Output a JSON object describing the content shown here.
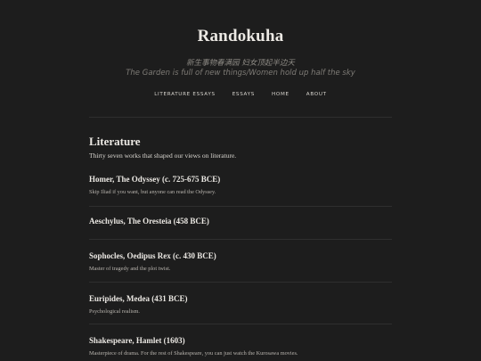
{
  "header": {
    "title": "Randokuha",
    "tagline_cn": "新生事物春满园 妇女顶起半边天",
    "tagline_en": "The Garden is full of new things/Women hold up half the sky"
  },
  "nav": {
    "items": [
      "LITERATURE ESSAYS",
      "ESSAYS",
      "HOME",
      "ABOUT"
    ]
  },
  "section": {
    "title": "Literature",
    "description": "Thirty seven works that shaped our views on literature."
  },
  "entries": [
    {
      "title": "Homer, The Odyssey (c. 725-675 BCE)",
      "description": "Skip Iliad if you want, but anyone can read the Odyssey."
    },
    {
      "title": "Aeschylus, The Oresteia (458 BCE)",
      "description": ""
    },
    {
      "title": "Sophocles, Oedipus Rex (c. 430 BCE)",
      "description": "Master of tragedy and the plot twist."
    },
    {
      "title": "Euripides, Medea (431 BCE)",
      "description": "Psychological realism."
    },
    {
      "title": "Shakespeare, Hamlet (1603)",
      "description": "Masterpiece of drama. For the rest of Shakespeare, you can just watch the Kurosawa movies."
    }
  ]
}
